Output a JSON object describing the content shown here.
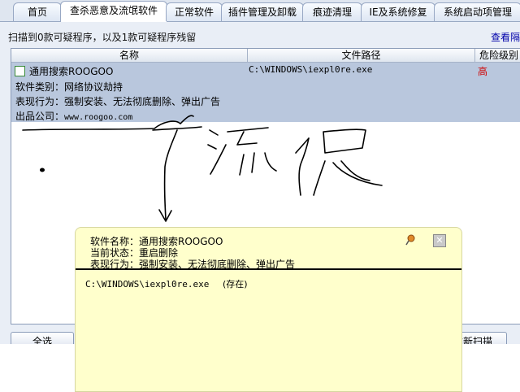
{
  "tabs": [
    {
      "label": "首页"
    },
    {
      "label": "查杀恶意及流氓软件"
    },
    {
      "label": "正常软件"
    },
    {
      "label": "插件管理及卸载"
    },
    {
      "label": "痕迹清理"
    },
    {
      "label": "IE及系统修复"
    },
    {
      "label": "系统启动项管理"
    }
  ],
  "active_tab": 1,
  "scan_summary": "扫描到0款可疑程序，以及1款可疑程序残留",
  "view_link": "查看隔",
  "columns": {
    "name": "名称",
    "path": "文件路径",
    "risk": "危险级别"
  },
  "row": {
    "name": "通用搜索ROOGOO",
    "path": "C:\\WINDOWS\\iexpl0re.exe",
    "risk": "高",
    "category": "软件类别：网络协议劫持",
    "behavior": "表现行为：强制安装、无法彻底删除、弹出广告",
    "company_label": "出品公司：",
    "company_url": "www.roogoo.com"
  },
  "buttons": {
    "select_all": "全选",
    "rescan": "重新扫描"
  },
  "popup": {
    "name_line": "软件名称：通用搜索ROOGOO",
    "status_line": "当前状态：重启删除",
    "behavior_line": "表现行为：强制安装、无法彻底删除、弹出广告",
    "file_path": "C:\\WINDOWS\\iexpl0re.exe",
    "file_status": "(存在)"
  },
  "colors": {
    "risk_high": "#d00000",
    "selected_row": "#b9c7dd",
    "popup_bg": "#ffffcc"
  },
  "icons": {
    "pin": "pin-icon",
    "close": "close-icon"
  }
}
